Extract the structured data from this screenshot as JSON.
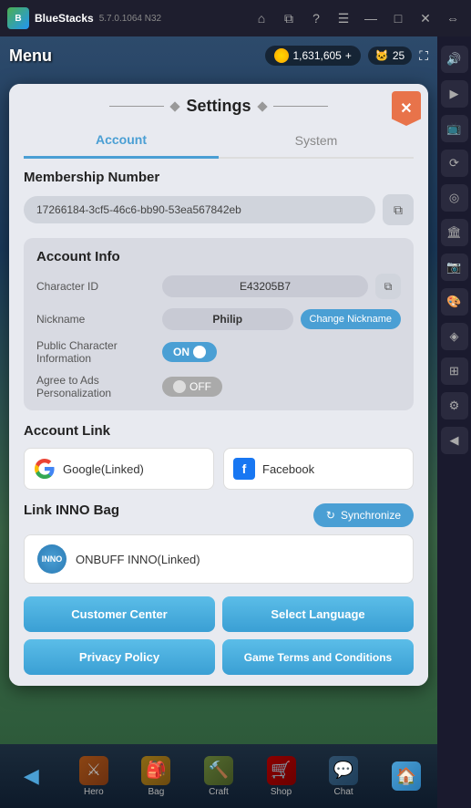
{
  "bluestacks": {
    "title": "BlueStacks",
    "version": "5.7.0.1064  N32",
    "icons": [
      "home",
      "layers",
      "question",
      "menu",
      "minus",
      "square",
      "close",
      "arrows"
    ]
  },
  "game": {
    "menu_label": "Menu",
    "currency": "1,631,605",
    "pet_count": "25"
  },
  "settings": {
    "title": "Settings",
    "close_label": "✕",
    "tabs": [
      {
        "id": "account",
        "label": "Account",
        "active": true
      },
      {
        "id": "system",
        "label": "System",
        "active": false
      }
    ],
    "membership": {
      "section_title": "Membership Number",
      "number": "17266184-3cf5-46c6-bb90-53ea567842eb"
    },
    "account_info": {
      "section_title": "Account Info",
      "character_id_label": "Character ID",
      "character_id_value": "E43205B7",
      "nickname_label": "Nickname",
      "nickname_value": "Philip",
      "change_nickname_label": "Change Nickname",
      "public_info_label": "Public Character Information",
      "public_info_value": "ON",
      "ads_label": "Agree to Ads Personalization",
      "ads_value": "OFF"
    },
    "account_link": {
      "section_title": "Account Link",
      "google_label": "Google(Linked)",
      "facebook_label": "Facebook"
    },
    "inno_bag": {
      "section_title": "Link INNO Bag",
      "sync_label": "Synchronize",
      "inno_label": "ONBUFF INNO(Linked)",
      "inno_short": "INNO"
    },
    "bottom_buttons": [
      {
        "id": "customer-center",
        "label": "Customer Center"
      },
      {
        "id": "select-language",
        "label": "Select Language"
      },
      {
        "id": "privacy-policy",
        "label": "Privacy Policy"
      },
      {
        "id": "game-terms",
        "label": "Game Terms and Conditions"
      }
    ]
  },
  "bottom_nav": {
    "items": [
      {
        "id": "back",
        "label": "←",
        "icon": "◀",
        "text": ""
      },
      {
        "id": "hero",
        "label": "Hero",
        "icon": "⚔"
      },
      {
        "id": "bag",
        "label": "Bag",
        "icon": "🎒"
      },
      {
        "id": "craft",
        "label": "Craft",
        "icon": "🔨"
      },
      {
        "id": "shop",
        "label": "Shop",
        "icon": "🏪"
      },
      {
        "id": "chat",
        "label": "Chat",
        "icon": "💬"
      },
      {
        "id": "home",
        "label": "🏠",
        "icon": "🏠"
      }
    ]
  },
  "sidebar": {
    "icons": [
      "🔊",
      "▶",
      "⚙",
      "📺",
      "⟳",
      "◉",
      "🏛",
      "📷",
      "🎨",
      "◈",
      "⊞",
      "⚙",
      "◀"
    ]
  }
}
